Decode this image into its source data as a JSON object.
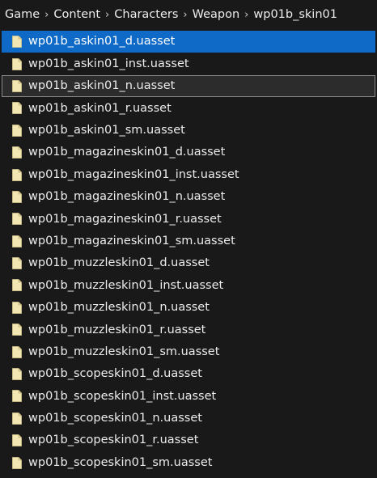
{
  "breadcrumb": {
    "items": [
      "Game",
      "Content",
      "Characters",
      "Weapon",
      "wp01b_skin01"
    ],
    "separator": "›"
  },
  "files": [
    {
      "name": "wp01b_askin01_d.uasset",
      "state": "selected"
    },
    {
      "name": "wp01b_askin01_inst.uasset",
      "state": ""
    },
    {
      "name": "wp01b_askin01_n.uasset",
      "state": "focused"
    },
    {
      "name": "wp01b_askin01_r.uasset",
      "state": ""
    },
    {
      "name": "wp01b_askin01_sm.uasset",
      "state": ""
    },
    {
      "name": "wp01b_magazineskin01_d.uasset",
      "state": ""
    },
    {
      "name": "wp01b_magazineskin01_inst.uasset",
      "state": ""
    },
    {
      "name": "wp01b_magazineskin01_n.uasset",
      "state": ""
    },
    {
      "name": "wp01b_magazineskin01_r.uasset",
      "state": ""
    },
    {
      "name": "wp01b_magazineskin01_sm.uasset",
      "state": ""
    },
    {
      "name": "wp01b_muzzleskin01_d.uasset",
      "state": ""
    },
    {
      "name": "wp01b_muzzleskin01_inst.uasset",
      "state": ""
    },
    {
      "name": "wp01b_muzzleskin01_n.uasset",
      "state": ""
    },
    {
      "name": "wp01b_muzzleskin01_r.uasset",
      "state": ""
    },
    {
      "name": "wp01b_muzzleskin01_sm.uasset",
      "state": ""
    },
    {
      "name": "wp01b_scopeskin01_d.uasset",
      "state": ""
    },
    {
      "name": "wp01b_scopeskin01_inst.uasset",
      "state": ""
    },
    {
      "name": "wp01b_scopeskin01_n.uasset",
      "state": ""
    },
    {
      "name": "wp01b_scopeskin01_r.uasset",
      "state": ""
    },
    {
      "name": "wp01b_scopeskin01_sm.uasset",
      "state": ""
    }
  ],
  "icons": {
    "file": "file-icon"
  },
  "colors": {
    "background": "#191919",
    "selection": "#0e6ac6",
    "focus_border": "#8a8a8a",
    "file_icon": "#f2e6b3"
  }
}
